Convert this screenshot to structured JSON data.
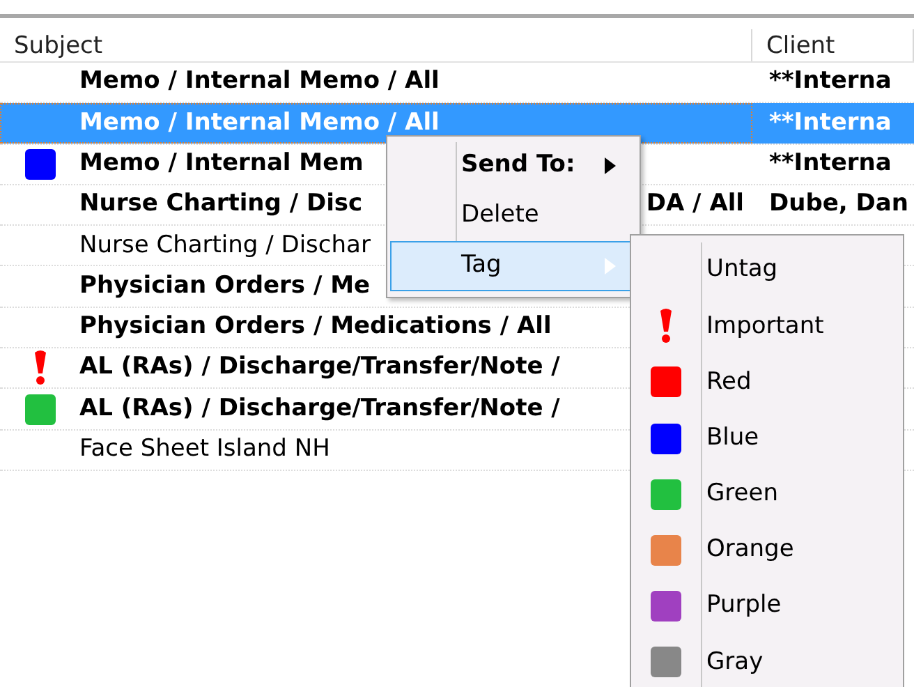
{
  "table": {
    "columns": [
      "Subject",
      "Client"
    ],
    "rows": [
      {
        "subject": "Memo / Internal Memo / All",
        "client": "**Interna",
        "bold": true,
        "selected": false
      },
      {
        "subject": "Memo / Internal Memo / All",
        "client": "**Interna",
        "bold": true,
        "selected": true
      },
      {
        "subject": "Memo / Internal Mem",
        "client": "**Interna",
        "bold": true,
        "selected": false,
        "tag": {
          "kind": "color",
          "color": "#0000ff"
        }
      },
      {
        "subject": "Nurse Charting / Disc",
        "subject_tail": "DA / All",
        "client": "Dube, Dan",
        "bold": true,
        "selected": false
      },
      {
        "subject": "Nurse Charting / Dischar",
        "bold": false,
        "selected": false
      },
      {
        "subject": "Physician Orders / Me",
        "bold": true,
        "selected": false
      },
      {
        "subject": "Physician Orders / Medications / All",
        "bold": true,
        "selected": false
      },
      {
        "subject": "AL (RAs) / Discharge/Transfer/Note /",
        "bold": true,
        "selected": false,
        "tag": {
          "kind": "important"
        }
      },
      {
        "subject": "AL (RAs) / Discharge/Transfer/Note /",
        "bold": true,
        "selected": false,
        "tag": {
          "kind": "color",
          "color": "#22c040"
        }
      },
      {
        "subject": "Face Sheet Island NH",
        "bold": false,
        "selected": false
      }
    ]
  },
  "context_menu": {
    "items": [
      {
        "label": "Send To:",
        "kind": "submenu",
        "bold": true,
        "selected": false
      },
      {
        "label": "Delete",
        "kind": "plain",
        "bold": false,
        "selected": false
      },
      {
        "label": "Tag",
        "kind": "submenu",
        "bold": false,
        "selected": true
      }
    ]
  },
  "tag_submenu": {
    "items": [
      {
        "label": "Untag",
        "kind": "none"
      },
      {
        "label": "Important",
        "kind": "important"
      },
      {
        "label": "Red",
        "kind": "color",
        "color": "#ff0000"
      },
      {
        "label": "Blue",
        "kind": "color",
        "color": "#0000ff"
      },
      {
        "label": "Green",
        "kind": "color",
        "color": "#22c040"
      },
      {
        "label": "Orange",
        "kind": "color",
        "color": "#e8844a"
      },
      {
        "label": "Purple",
        "kind": "color",
        "color": "#a040c0"
      },
      {
        "label": "Gray",
        "kind": "color",
        "color": "#888888"
      }
    ]
  }
}
